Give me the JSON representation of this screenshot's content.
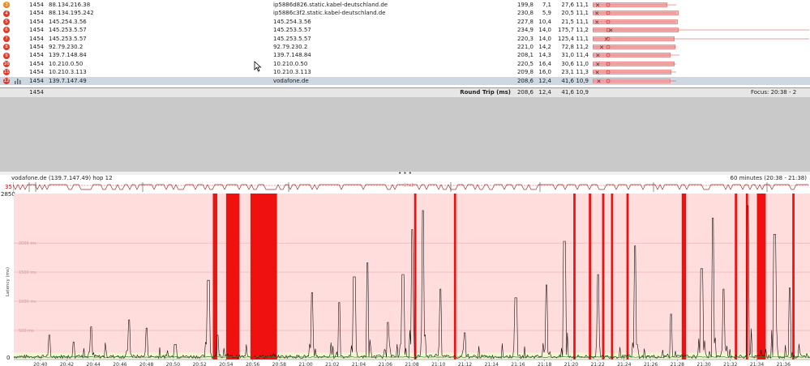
{
  "hops": [
    {
      "hop": "3",
      "badge_color": "#ee8a1c",
      "count": "1454",
      "ip": "88.134.216.38",
      "name": "ip5886d826.static.kabel-deutschland.de",
      "avg": "199,8",
      "min": "7,1",
      "cur": "27,6",
      "pl": "11,1"
    },
    {
      "hop": "4",
      "badge_color": "#e03b2a",
      "count": "1454",
      "ip": "88.134.195.242",
      "name": "ip5886c3f2.static.kabel-deutschland.de",
      "avg": "230,8",
      "min": "5,9",
      "cur": "20,5",
      "pl": "11,1"
    },
    {
      "hop": "5",
      "badge_color": "#e03b2a",
      "count": "1454",
      "ip": "145.254.3.56",
      "name": "145.254.3.56",
      "avg": "227,8",
      "min": "10,4",
      "cur": "21,5",
      "pl": "11,1"
    },
    {
      "hop": "6",
      "badge_color": "#e03b2a",
      "count": "1454",
      "ip": "145.253.5.57",
      "name": "145.253.5.57",
      "avg": "234,9",
      "min": "14,0",
      "cur": "175,7",
      "pl": "11,2"
    },
    {
      "hop": "7",
      "badge_color": "#e03b2a",
      "count": "1454",
      "ip": "145.253.5.57",
      "name": "145.253.5.57",
      "avg": "220,3",
      "min": "14,0",
      "cur": "125,4",
      "pl": "11,1"
    },
    {
      "hop": "8",
      "badge_color": "#e03b2a",
      "count": "1454",
      "ip": "92.79.230.2",
      "name": "92.79.230.2",
      "avg": "221,0",
      "min": "14,2",
      "cur": "72,8",
      "pl": "11,2"
    },
    {
      "hop": "9",
      "badge_color": "#e03b2a",
      "count": "1454",
      "ip": "139.7.148.84",
      "name": "139.7.148.84",
      "avg": "208,1",
      "min": "14,3",
      "cur": "31,0",
      "pl": "11,4"
    },
    {
      "hop": "10",
      "badge_color": "#e03b2a",
      "count": "1454",
      "ip": "10.210.0.50",
      "name": "10.210.0.50",
      "avg": "220,5",
      "min": "16,4",
      "cur": "30,6",
      "pl": "11,0"
    },
    {
      "hop": "11",
      "badge_color": "#e03b2a",
      "count": "1454",
      "ip": "10.210.3.113",
      "name": "10.210.3.113",
      "avg": "209,8",
      "min": "16,0",
      "cur": "23,1",
      "pl": "11,3"
    },
    {
      "hop": "12",
      "badge_color": "#e03b2a",
      "count": "1454",
      "ip": "139.7.147.49",
      "name": "vodafone.de",
      "avg": "208,6",
      "min": "12,4",
      "cur": "41,6",
      "pl": "10,9"
    }
  ],
  "summary": {
    "count": "1454",
    "label": "Round Trip (ms)",
    "avg": "208,6",
    "min": "12,4",
    "cur": "41,6",
    "pl": "10,9",
    "focus": "Focus: 20:38 - 2"
  },
  "graph": {
    "title": "vodafone.de (139.7.147.49) hop 12",
    "window": "60 minutes (20:38 - 21:38)",
    "mini_value": "35",
    "mini_marker": "(ms)",
    "ylabel": "Latency (ms)",
    "ymax_label": "2850",
    "y0_label": "0",
    "y_ticks": [
      "2000 ms",
      "1500 ms",
      "1000 ms",
      "500 ms"
    ]
  },
  "splitter_grip": "• • •",
  "chart_data": {
    "type": "line",
    "title": "vodafone.de (139.7.147.49) hop 12",
    "ylabel": "Latency (ms)",
    "ylim": [
      0,
      2850
    ],
    "x": [
      "20:40",
      "20:42",
      "20:44",
      "20:46",
      "20:48",
      "20:50",
      "20:52",
      "20:54",
      "20:56",
      "20:58",
      "21:00",
      "21:02",
      "21:04",
      "21:06",
      "21:08",
      "21:10",
      "21:12",
      "21:14",
      "21:16",
      "21:18",
      "21:20",
      "21:22",
      "21:24",
      "21:26",
      "21:28",
      "21:30",
      "21:32",
      "21:34",
      "21:36"
    ],
    "loss_bands": [
      [
        "20:53:00",
        "20:53:20"
      ],
      [
        "20:54:00",
        "20:55:00"
      ],
      [
        "20:55:50",
        "20:57:50"
      ],
      [
        "21:08:10",
        "21:08:20"
      ],
      [
        "21:11:10",
        "21:11:20"
      ],
      [
        "21:20:10",
        "21:20:20"
      ],
      [
        "21:21:20",
        "21:21:30"
      ],
      [
        "21:22:20",
        "21:22:30"
      ],
      [
        "21:23:00",
        "21:23:10"
      ],
      [
        "21:24:10",
        "21:24:20"
      ],
      [
        "21:28:20",
        "21:28:40"
      ],
      [
        "21:32:20",
        "21:32:30"
      ],
      [
        "21:33:10",
        "21:33:20"
      ],
      [
        "21:34:00",
        "21:34:40"
      ],
      [
        "21:36:40",
        "21:36:50"
      ]
    ],
    "spikes": [
      [
        "20:40:40",
        420
      ],
      [
        "20:42:30",
        300
      ],
      [
        "20:43:50",
        560
      ],
      [
        "20:46:40",
        680
      ],
      [
        "20:48:00",
        540
      ],
      [
        "20:50:10",
        260
      ],
      [
        "20:52:40",
        1360
      ],
      [
        "20:53:20",
        420
      ],
      [
        "21:00:30",
        1150
      ],
      [
        "21:02:30",
        980
      ],
      [
        "21:03:40",
        1420
      ],
      [
        "21:04:40",
        1660
      ],
      [
        "21:06:10",
        640
      ],
      [
        "21:07:20",
        1460
      ],
      [
        "21:08:00",
        2230
      ],
      [
        "21:08:50",
        2560
      ],
      [
        "21:10:10",
        1210
      ],
      [
        "21:12:00",
        460
      ],
      [
        "21:15:50",
        1060
      ],
      [
        "21:18:10",
        1280
      ],
      [
        "21:19:30",
        2030
      ],
      [
        "21:22:00",
        1460
      ],
      [
        "21:24:50",
        1950
      ],
      [
        "21:27:30",
        780
      ],
      [
        "21:29:50",
        1560
      ],
      [
        "21:30:40",
        2430
      ],
      [
        "21:31:30",
        1210
      ],
      [
        "21:33:20",
        2640
      ],
      [
        "21:35:20",
        2150
      ],
      [
        "21:36:30",
        1230
      ]
    ]
  }
}
